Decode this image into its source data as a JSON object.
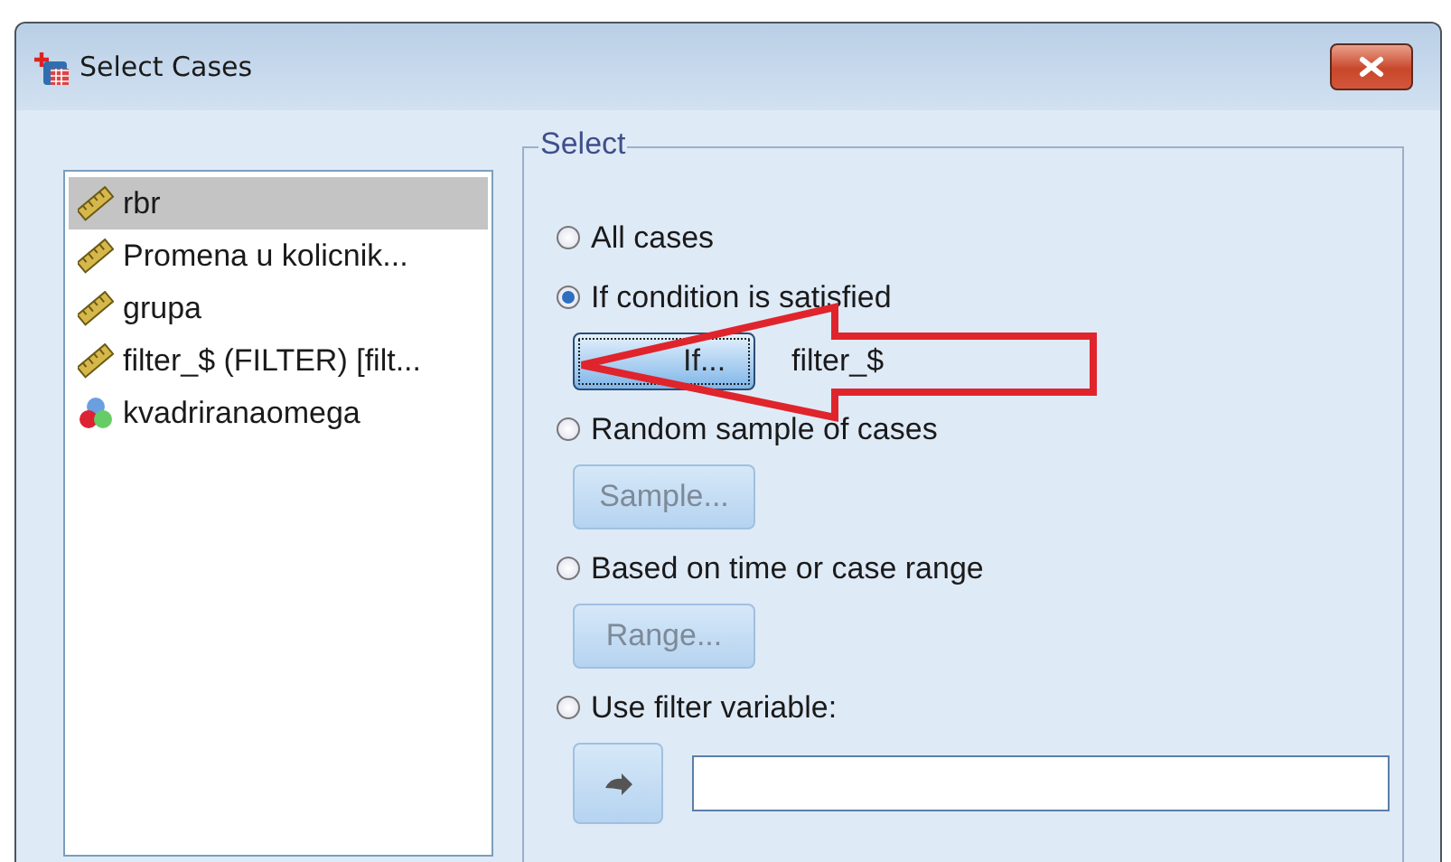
{
  "window": {
    "title": "Select Cases"
  },
  "variables": [
    {
      "name": "rbr",
      "kind": "scale",
      "selected": true
    },
    {
      "name": "Promena u kolicnik...",
      "kind": "scale",
      "selected": false
    },
    {
      "name": "grupa",
      "kind": "scale",
      "selected": false
    },
    {
      "name": "filter_$ (FILTER) [filt...",
      "kind": "scale",
      "selected": false
    },
    {
      "name": "kvadriranaomega",
      "kind": "nominal",
      "selected": false
    }
  ],
  "select_group": {
    "legend": "Select",
    "options": [
      {
        "kind": "plain",
        "label": "All cases",
        "selected": false
      },
      {
        "kind": "button",
        "label": "If condition is satisfied",
        "selected": true,
        "button": {
          "label": "If...",
          "disabled": false,
          "focused": true
        },
        "condition": "filter_$"
      },
      {
        "kind": "button",
        "label": "Random sample of cases",
        "selected": false,
        "button": {
          "label": "Sample...",
          "disabled": true,
          "focused": false
        }
      },
      {
        "kind": "button",
        "label": "Based on time or case range",
        "selected": false,
        "button": {
          "label": "Range...",
          "disabled": true,
          "focused": false
        }
      },
      {
        "kind": "field",
        "label": "Use filter variable:",
        "selected": false
      }
    ]
  },
  "annotation": {
    "kind": "arrow"
  }
}
